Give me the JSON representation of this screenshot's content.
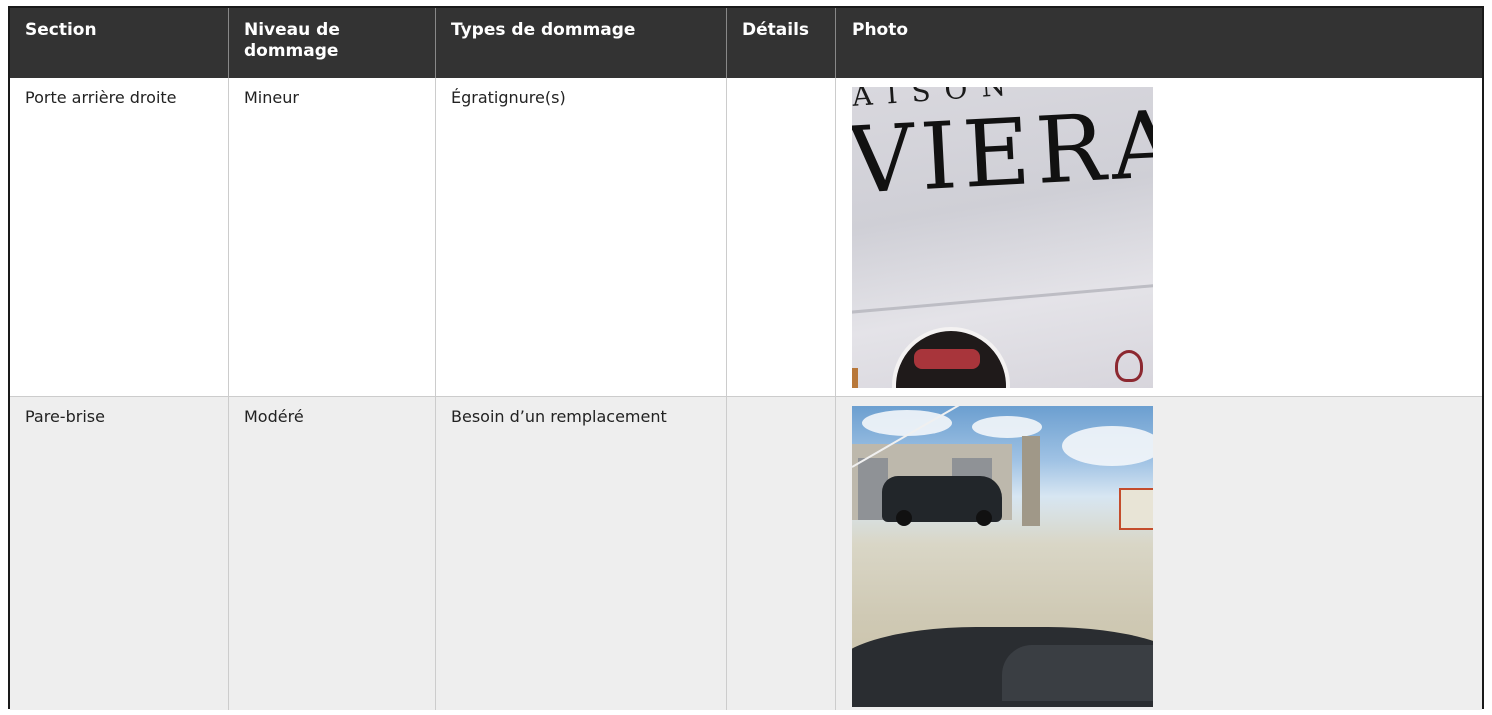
{
  "table": {
    "headers": [
      "Section",
      "Niveau de dommage",
      "Types de dommage",
      "Détails",
      "Photo"
    ],
    "rows": [
      {
        "section": "Porte arrière droite",
        "niveau": "Mineur",
        "types": "Égratignure(s)",
        "details": "",
        "photo_lettering": [
          "AISON",
          "VIERA"
        ]
      },
      {
        "section": "Pare-brise",
        "niveau": "Modéré",
        "types": "Besoin d’un remplacement",
        "details": ""
      }
    ]
  },
  "colors": {
    "header_bg": "#333333",
    "header_text": "#ffffff",
    "row_alt_bg": "#eeeeee",
    "border": "#cccccc"
  }
}
